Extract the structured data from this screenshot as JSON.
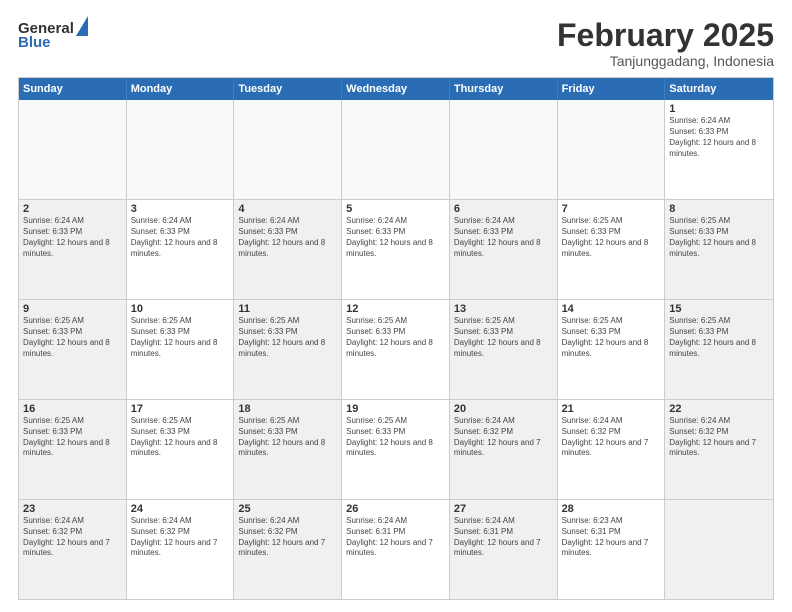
{
  "logo": {
    "text1": "General",
    "text2": "Blue"
  },
  "title": "February 2025",
  "subtitle": "Tanjunggadang, Indonesia",
  "header": {
    "days": [
      "Sunday",
      "Monday",
      "Tuesday",
      "Wednesday",
      "Thursday",
      "Friday",
      "Saturday"
    ]
  },
  "rows": [
    {
      "cells": [
        {
          "day": "",
          "info": "",
          "empty": true
        },
        {
          "day": "",
          "info": "",
          "empty": true
        },
        {
          "day": "",
          "info": "",
          "empty": true
        },
        {
          "day": "",
          "info": "",
          "empty": true
        },
        {
          "day": "",
          "info": "",
          "empty": true
        },
        {
          "day": "",
          "info": "",
          "empty": true
        },
        {
          "day": "1",
          "info": "Sunrise: 6:24 AM\nSunset: 6:33 PM\nDaylight: 12 hours and 8 minutes.",
          "empty": false
        }
      ]
    },
    {
      "cells": [
        {
          "day": "2",
          "info": "Sunrise: 6:24 AM\nSunset: 6:33 PM\nDaylight: 12 hours and 8 minutes.",
          "empty": false,
          "shaded": true
        },
        {
          "day": "3",
          "info": "Sunrise: 6:24 AM\nSunset: 6:33 PM\nDaylight: 12 hours and 8 minutes.",
          "empty": false
        },
        {
          "day": "4",
          "info": "Sunrise: 6:24 AM\nSunset: 6:33 PM\nDaylight: 12 hours and 8 minutes.",
          "empty": false,
          "shaded": true
        },
        {
          "day": "5",
          "info": "Sunrise: 6:24 AM\nSunset: 6:33 PM\nDaylight: 12 hours and 8 minutes.",
          "empty": false
        },
        {
          "day": "6",
          "info": "Sunrise: 6:24 AM\nSunset: 6:33 PM\nDaylight: 12 hours and 8 minutes.",
          "empty": false,
          "shaded": true
        },
        {
          "day": "7",
          "info": "Sunrise: 6:25 AM\nSunset: 6:33 PM\nDaylight: 12 hours and 8 minutes.",
          "empty": false
        },
        {
          "day": "8",
          "info": "Sunrise: 6:25 AM\nSunset: 6:33 PM\nDaylight: 12 hours and 8 minutes.",
          "empty": false,
          "shaded": true
        }
      ]
    },
    {
      "cells": [
        {
          "day": "9",
          "info": "Sunrise: 6:25 AM\nSunset: 6:33 PM\nDaylight: 12 hours and 8 minutes.",
          "empty": false,
          "shaded": true
        },
        {
          "day": "10",
          "info": "Sunrise: 6:25 AM\nSunset: 6:33 PM\nDaylight: 12 hours and 8 minutes.",
          "empty": false
        },
        {
          "day": "11",
          "info": "Sunrise: 6:25 AM\nSunset: 6:33 PM\nDaylight: 12 hours and 8 minutes.",
          "empty": false,
          "shaded": true
        },
        {
          "day": "12",
          "info": "Sunrise: 6:25 AM\nSunset: 6:33 PM\nDaylight: 12 hours and 8 minutes.",
          "empty": false
        },
        {
          "day": "13",
          "info": "Sunrise: 6:25 AM\nSunset: 6:33 PM\nDaylight: 12 hours and 8 minutes.",
          "empty": false,
          "shaded": true
        },
        {
          "day": "14",
          "info": "Sunrise: 6:25 AM\nSunset: 6:33 PM\nDaylight: 12 hours and 8 minutes.",
          "empty": false
        },
        {
          "day": "15",
          "info": "Sunrise: 6:25 AM\nSunset: 6:33 PM\nDaylight: 12 hours and 8 minutes.",
          "empty": false,
          "shaded": true
        }
      ]
    },
    {
      "cells": [
        {
          "day": "16",
          "info": "Sunrise: 6:25 AM\nSunset: 6:33 PM\nDaylight: 12 hours and 8 minutes.",
          "empty": false,
          "shaded": true
        },
        {
          "day": "17",
          "info": "Sunrise: 6:25 AM\nSunset: 6:33 PM\nDaylight: 12 hours and 8 minutes.",
          "empty": false
        },
        {
          "day": "18",
          "info": "Sunrise: 6:25 AM\nSunset: 6:33 PM\nDaylight: 12 hours and 8 minutes.",
          "empty": false,
          "shaded": true
        },
        {
          "day": "19",
          "info": "Sunrise: 6:25 AM\nSunset: 6:33 PM\nDaylight: 12 hours and 8 minutes.",
          "empty": false
        },
        {
          "day": "20",
          "info": "Sunrise: 6:24 AM\nSunset: 6:32 PM\nDaylight: 12 hours and 7 minutes.",
          "empty": false,
          "shaded": true
        },
        {
          "day": "21",
          "info": "Sunrise: 6:24 AM\nSunset: 6:32 PM\nDaylight: 12 hours and 7 minutes.",
          "empty": false
        },
        {
          "day": "22",
          "info": "Sunrise: 6:24 AM\nSunset: 6:32 PM\nDaylight: 12 hours and 7 minutes.",
          "empty": false,
          "shaded": true
        }
      ]
    },
    {
      "cells": [
        {
          "day": "23",
          "info": "Sunrise: 6:24 AM\nSunset: 6:32 PM\nDaylight: 12 hours and 7 minutes.",
          "empty": false,
          "shaded": true
        },
        {
          "day": "24",
          "info": "Sunrise: 6:24 AM\nSunset: 6:32 PM\nDaylight: 12 hours and 7 minutes.",
          "empty": false
        },
        {
          "day": "25",
          "info": "Sunrise: 6:24 AM\nSunset: 6:32 PM\nDaylight: 12 hours and 7 minutes.",
          "empty": false,
          "shaded": true
        },
        {
          "day": "26",
          "info": "Sunrise: 6:24 AM\nSunset: 6:31 PM\nDaylight: 12 hours and 7 minutes.",
          "empty": false
        },
        {
          "day": "27",
          "info": "Sunrise: 6:24 AM\nSunset: 6:31 PM\nDaylight: 12 hours and 7 minutes.",
          "empty": false,
          "shaded": true
        },
        {
          "day": "28",
          "info": "Sunrise: 6:23 AM\nSunset: 6:31 PM\nDaylight: 12 hours and 7 minutes.",
          "empty": false
        },
        {
          "day": "",
          "info": "",
          "empty": true,
          "shaded": true
        }
      ]
    }
  ]
}
